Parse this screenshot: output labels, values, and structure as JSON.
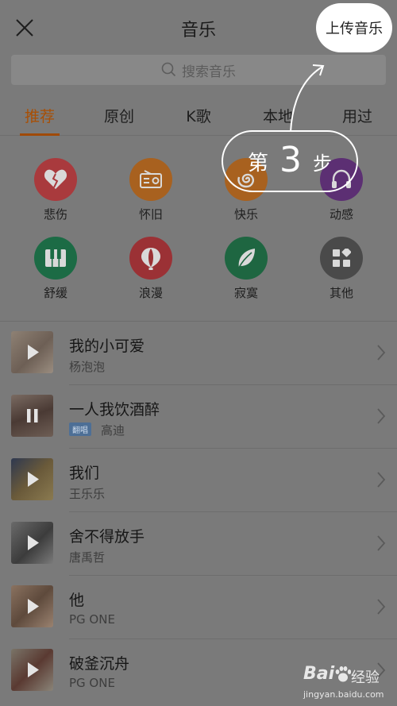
{
  "header": {
    "title": "音乐",
    "upload_label": "上传音乐"
  },
  "search": {
    "placeholder": "搜索音乐"
  },
  "tabs": [
    {
      "label": "推荐",
      "active": true
    },
    {
      "label": "原创",
      "active": false
    },
    {
      "label": "K歌",
      "active": false
    },
    {
      "label": "本地",
      "active": false
    },
    {
      "label": "用过",
      "active": false
    }
  ],
  "moods": [
    {
      "label": "悲伤",
      "icon": "broken-heart-icon",
      "color": "#a93a3d"
    },
    {
      "label": "怀旧",
      "icon": "radio-icon",
      "color": "#a8611f"
    },
    {
      "label": "快乐",
      "icon": "swirl-icon",
      "color": "#a8611f"
    },
    {
      "label": "动感",
      "icon": "headphones-icon",
      "color": "#5c2f73"
    },
    {
      "label": "舒缓",
      "icon": "piano-icon",
      "color": "#1c6b45"
    },
    {
      "label": "浪漫",
      "icon": "balloon-icon",
      "color": "#9b3135"
    },
    {
      "label": "寂寞",
      "icon": "leaf-icon",
      "color": "#1e6641"
    },
    {
      "label": "其他",
      "icon": "grid-icon",
      "color": "#4a4a4a"
    }
  ],
  "songs": [
    {
      "title": "我的小可爱",
      "artist": "杨泡泡",
      "badge": "",
      "state": "play"
    },
    {
      "title": "一人我饮酒醉",
      "artist": "高迪",
      "badge": "翻唱",
      "state": "pause"
    },
    {
      "title": "我们",
      "artist": "王乐乐",
      "badge": "",
      "state": "play"
    },
    {
      "title": "舍不得放手",
      "artist": "唐禹哲",
      "badge": "",
      "state": "play"
    },
    {
      "title": "他",
      "artist": "PG ONE",
      "badge": "",
      "state": "play"
    },
    {
      "title": "破釜沉舟",
      "artist": "PG ONE",
      "badge": "",
      "state": "play"
    }
  ],
  "overlay": {
    "step_prefix": "第",
    "step_number": "3",
    "step_suffix": "步"
  },
  "watermark": {
    "brand": "Bai",
    "brand_cn": "经验",
    "url": "jingyan.baidu.com"
  },
  "colors": {
    "accent": "#a04a08",
    "overlay_bg": "#7a7a7a"
  }
}
